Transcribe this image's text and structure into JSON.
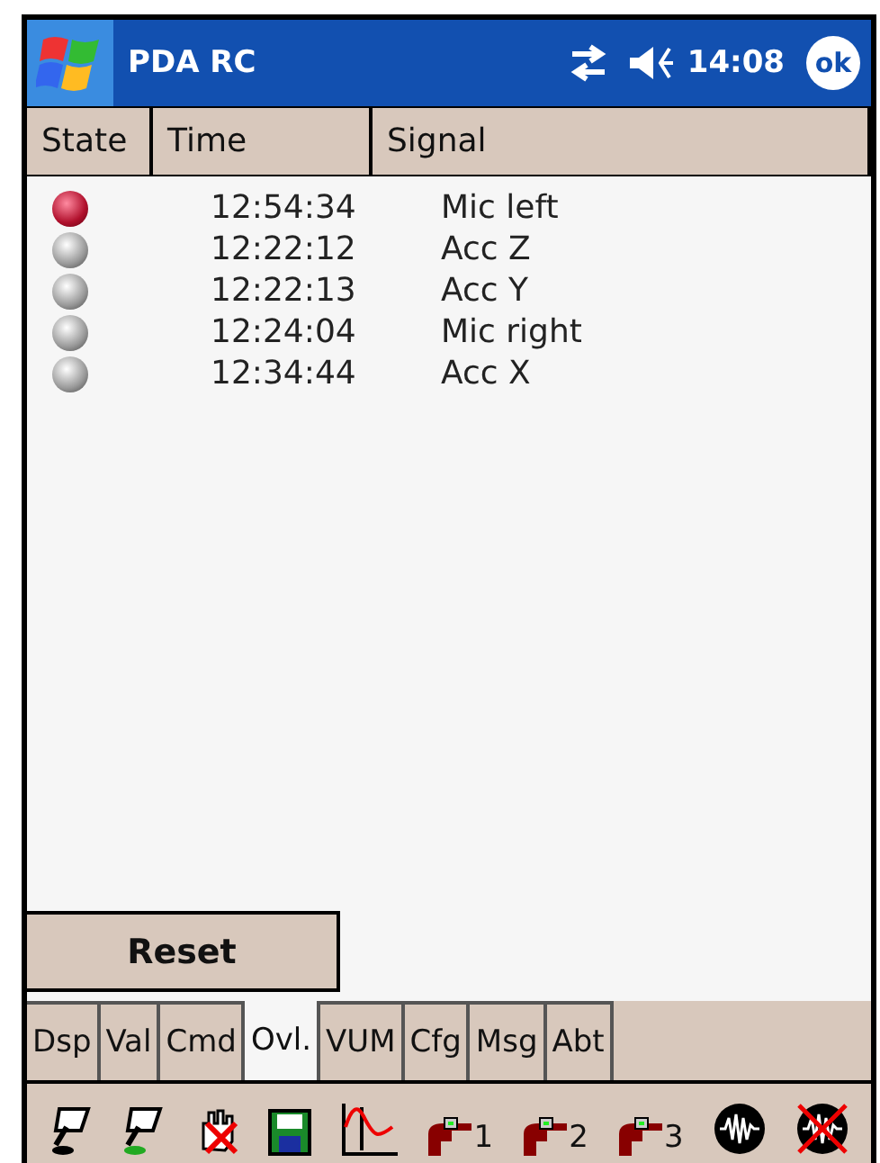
{
  "title_bar": {
    "title": "PDA RC",
    "time": "14:08",
    "ok": "ok"
  },
  "table": {
    "columns": [
      "State",
      "Time",
      "Signal"
    ],
    "rows": [
      {
        "overloaded": true,
        "time": "12:54:34",
        "signal": "Mic left"
      },
      {
        "overloaded": false,
        "time": "12:22:12",
        "signal": "Acc Z"
      },
      {
        "overloaded": false,
        "time": "12:22:13",
        "signal": "Acc Y"
      },
      {
        "overloaded": false,
        "time": "12:24:04",
        "signal": "Mic right"
      },
      {
        "overloaded": false,
        "time": "12:34:44",
        "signal": "Acc X"
      }
    ]
  },
  "reset_button": "Reset",
  "tabs": [
    {
      "label": "Dsp",
      "selected": false
    },
    {
      "label": "Val",
      "selected": false
    },
    {
      "label": "Cmd",
      "selected": false
    },
    {
      "label": "Ovl.",
      "selected": true
    },
    {
      "label": "VUM",
      "selected": false
    },
    {
      "label": "Cfg",
      "selected": false
    },
    {
      "label": "Msg",
      "selected": false
    },
    {
      "label": "Abt",
      "selected": false
    }
  ],
  "toolbar": [
    {
      "kind": "stylus"
    },
    {
      "kind": "stylus-green"
    },
    {
      "kind": "hand-off"
    },
    {
      "kind": "save"
    },
    {
      "kind": "graph"
    },
    {
      "kind": "gun",
      "label": "1"
    },
    {
      "kind": "gun",
      "label": "2"
    },
    {
      "kind": "gun",
      "label": "3"
    },
    {
      "kind": "wave"
    },
    {
      "kind": "wave-off"
    }
  ]
}
